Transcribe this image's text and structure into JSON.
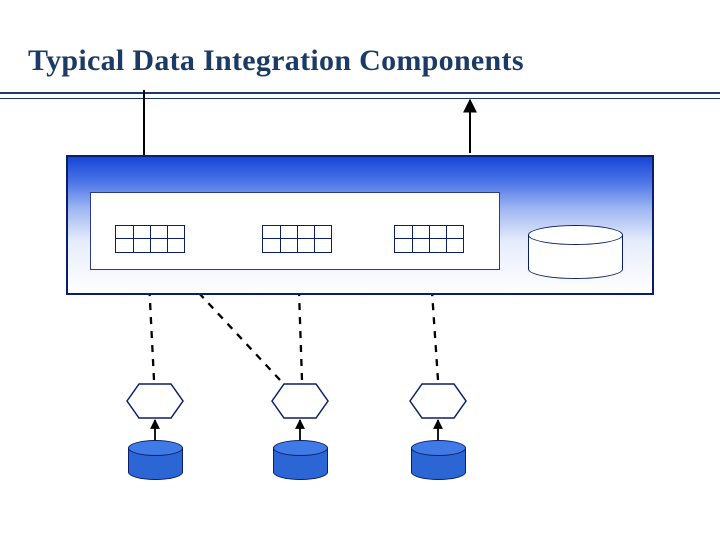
{
  "slide": {
    "title": "Typical Data Integration Components"
  },
  "diagram": {
    "container": {
      "role": "integration-layer",
      "inner_panel": {
        "role": "staging-area",
        "tables": [
          {
            "role": "staging-table"
          },
          {
            "role": "staging-table"
          },
          {
            "role": "staging-table"
          }
        ]
      },
      "datastore": {
        "role": "target-database"
      }
    },
    "processes": [
      {
        "role": "etl-process"
      },
      {
        "role": "etl-process"
      },
      {
        "role": "etl-process"
      }
    ],
    "sources": [
      {
        "role": "source-database"
      },
      {
        "role": "source-database"
      },
      {
        "role": "source-database"
      }
    ],
    "flows": {
      "incoming_arrow": {
        "role": "input-flow"
      },
      "outgoing_arrow": {
        "role": "output-flow"
      },
      "source_to_process": [
        {
          "from": "source-1",
          "to": "process-1"
        },
        {
          "from": "source-2",
          "to": "process-2"
        },
        {
          "from": "source-3",
          "to": "process-3"
        }
      ],
      "process_to_staging_dashed": [
        {
          "from": "process-1",
          "to": "staging-table-1"
        },
        {
          "from": "process-2",
          "to": "staging-table-1"
        },
        {
          "from": "process-2",
          "to": "staging-table-2"
        },
        {
          "from": "process-3",
          "to": "staging-table-3"
        }
      ]
    }
  }
}
